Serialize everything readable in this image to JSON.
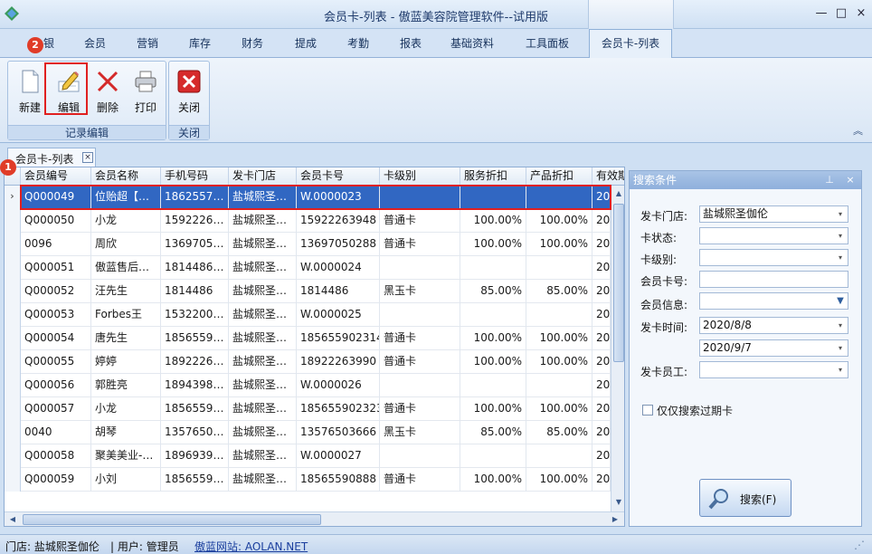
{
  "window": {
    "title": "会员卡-列表 - 傲蓝美容院管理软件--试用版",
    "minimize": "—",
    "restore": "□",
    "close": "×"
  },
  "ribbon_tabs": [
    "报表",
    "会员",
    "营销",
    "库存",
    "财务",
    "提成",
    "考勤",
    "报表",
    "基础资料",
    "工具面板"
  ],
  "first_tab_partial": "银",
  "active_tab": "会员卡-列表",
  "ribbon_groups": {
    "record_edit": {
      "label": "记录编辑",
      "buttons": [
        {
          "label": "新建",
          "icon": "new-document-icon"
        },
        {
          "label": "编辑",
          "icon": "edit-pencil-icon"
        },
        {
          "label": "删除",
          "icon": "delete-x-icon"
        },
        {
          "label": "打印",
          "icon": "printer-icon"
        }
      ]
    },
    "close": {
      "label": "关闭",
      "buttons": [
        {
          "label": "关闭",
          "icon": "close-red-icon"
        }
      ]
    }
  },
  "annotations": {
    "badge_1": "1",
    "badge_2": "2"
  },
  "document_tab": {
    "label": "会员卡-列表",
    "close": "×"
  },
  "grid": {
    "columns": [
      "会员编号",
      "会员名称",
      "手机号码",
      "发卡门店",
      "会员卡号",
      "卡级别",
      "服务折扣",
      "产品折扣",
      "有效期"
    ],
    "rows": [
      [
        "Q000049",
        "位贻超【…",
        "1862557…",
        "盐城熙圣…",
        "W.0000023",
        "",
        "",
        "",
        "20"
      ],
      [
        "Q000050",
        "小龙",
        "1592226…",
        "盐城熙圣…",
        "15922263948",
        "普通卡",
        "100.00%",
        "100.00%",
        "20"
      ],
      [
        "0096",
        "周欣",
        "1369705…",
        "盐城熙圣…",
        "13697050288",
        "普通卡",
        "100.00%",
        "100.00%",
        "20"
      ],
      [
        "Q000051",
        "傲蓝售后…",
        "1814486…",
        "盐城熙圣…",
        "W.0000024",
        "",
        "",
        "",
        "20"
      ],
      [
        "Q000052",
        "汪先生",
        "1814486",
        "盐城熙圣…",
        "1814486",
        "黑玉卡",
        "85.00%",
        "85.00%",
        "20"
      ],
      [
        "Q000053",
        "Forbes王",
        "1532200…",
        "盐城熙圣…",
        "W.0000025",
        "",
        "",
        "",
        "20"
      ],
      [
        "Q000054",
        "唐先生",
        "1856559…",
        "盐城熙圣…",
        "185655902314",
        "普通卡",
        "100.00%",
        "100.00%",
        "20"
      ],
      [
        "Q000055",
        "婷婷",
        "1892226…",
        "盐城熙圣…",
        "18922263990",
        "普通卡",
        "100.00%",
        "100.00%",
        "20"
      ],
      [
        "Q000056",
        "郭胜亮",
        "1894398…",
        "盐城熙圣…",
        "W.0000026",
        "",
        "",
        "",
        "20"
      ],
      [
        "Q000057",
        "小龙",
        "1856559…",
        "盐城熙圣…",
        "185655902323",
        "普通卡",
        "100.00%",
        "100.00%",
        "20"
      ],
      [
        "0040",
        "胡琴",
        "1357650…",
        "盐城熙圣…",
        "13576503666",
        "黑玉卡",
        "85.00%",
        "85.00%",
        "20"
      ],
      [
        "Q000058",
        "聚美美业-…",
        "1896939…",
        "盐城熙圣…",
        "W.0000027",
        "",
        "",
        "",
        "20"
      ],
      [
        "Q000059",
        "小刘",
        "1856559…",
        "盐城熙圣…",
        "18565590888",
        "普通卡",
        "100.00%",
        "100.00%",
        "20"
      ]
    ],
    "row_indicator": "›"
  },
  "search_panel": {
    "title": "搜索条件",
    "pin": "ꟷ",
    "close": "×",
    "fields": [
      {
        "label": "发卡门店:",
        "value": "盐城熙圣伽伦",
        "dropdown": true
      },
      {
        "label": "卡状态:",
        "value": "",
        "dropdown": true
      },
      {
        "label": "卡级别:",
        "value": "",
        "dropdown": true
      },
      {
        "label": "会员卡号:",
        "value": "",
        "dropdown": false
      },
      {
        "label": "会员信息:",
        "value": "",
        "dropdown": true
      },
      {
        "label": "发卡时间:",
        "value": "2020/8/8",
        "dropdown": true
      },
      {
        "label": "",
        "value": "2020/9/7",
        "dropdown": true
      },
      {
        "label": "发卡员工:",
        "value": "",
        "dropdown": true
      }
    ],
    "checkbox_label": "仅仅搜索过期卡",
    "search_button": "搜索(F)"
  },
  "statusbar": {
    "store": "门店: 盐城熙圣伽伦",
    "user": "| 用户: 管理员",
    "site": "傲蓝网站: AOLAN.NET"
  },
  "colors": {
    "selected_row": "#3167c2",
    "annotation_red": "#e02020",
    "badge": "#e03c28"
  }
}
